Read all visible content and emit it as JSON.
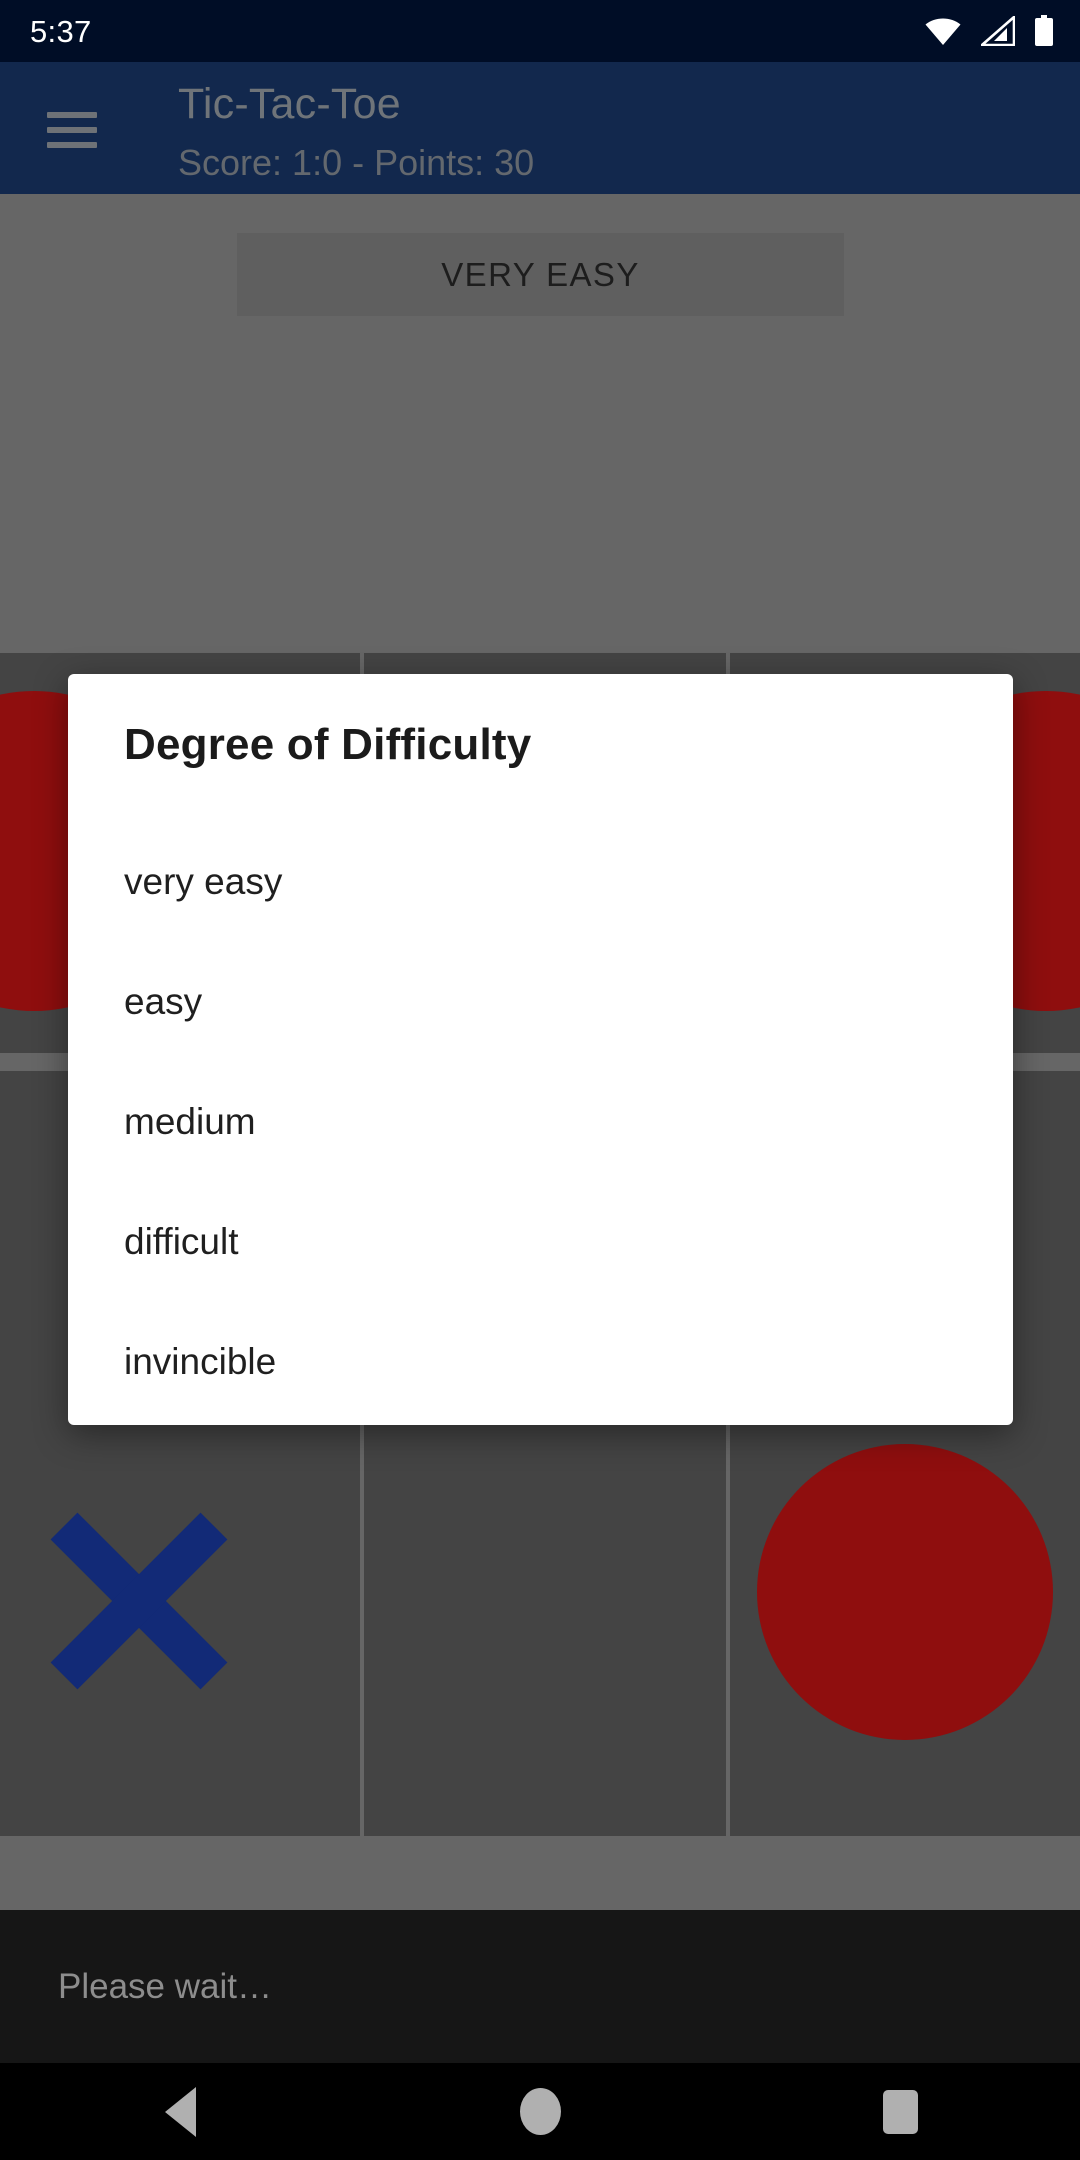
{
  "status_bar": {
    "clock": "5:37",
    "icons": [
      "wifi-icon",
      "cellular-signal-icon",
      "battery-icon"
    ]
  },
  "app_bar": {
    "menu_icon": "hamburger-menu-icon",
    "title": "Tic-Tac-Toe",
    "subtitle": "Score: 1:0 - Points: 30"
  },
  "main": {
    "difficulty_button_label": "VERY EASY",
    "board": {
      "rows": [
        [
          {
            "mark": "O"
          },
          {
            "mark": ""
          },
          {
            "mark": "O"
          }
        ],
        [
          {
            "mark": ""
          },
          {
            "mark": ""
          },
          {
            "mark": ""
          }
        ],
        [
          {
            "mark": "X"
          },
          {
            "mark": ""
          },
          {
            "mark": "O"
          }
        ]
      ],
      "x_color": "#122a77",
      "o_color": "#8f0e0e",
      "cell_color": "#444444"
    }
  },
  "dialog": {
    "title": "Degree of Difficulty",
    "options": [
      {
        "label": "very easy"
      },
      {
        "label": "easy"
      },
      {
        "label": "medium"
      },
      {
        "label": "difficult"
      },
      {
        "label": "invincible"
      }
    ]
  },
  "snackbar": {
    "message": "Please wait…"
  },
  "nav_bar": {
    "back_label": "back-button",
    "home_label": "home-button",
    "recents_label": "recents-button"
  },
  "colors": {
    "status_bar_bg": "#000d26",
    "app_bar_bg": "#12284d",
    "scrim": "#666666",
    "dialog_bg": "#ffffff",
    "snackbar_bg": "#161616"
  }
}
